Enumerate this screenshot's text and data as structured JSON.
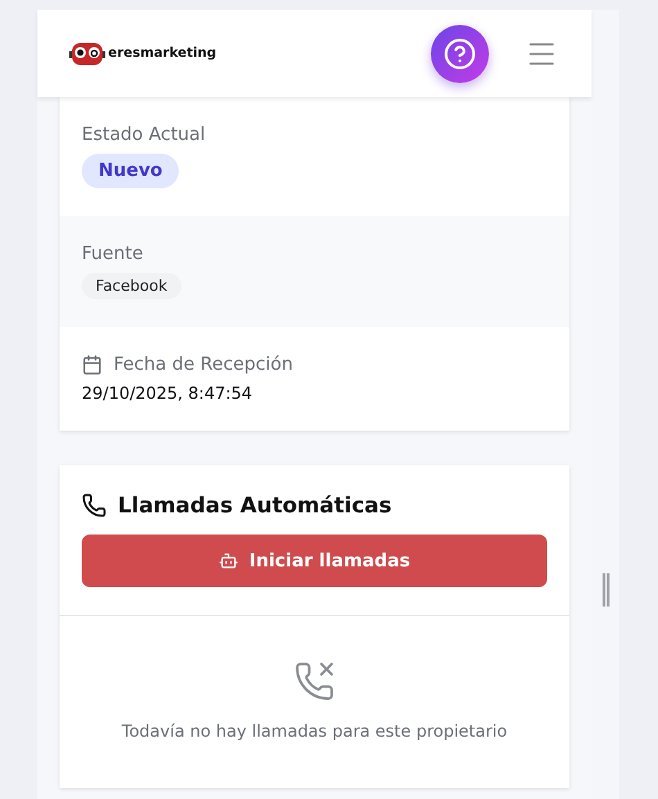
{
  "header": {
    "logo_text": "eresmarketing"
  },
  "details": [
    {
      "kind": "badge",
      "label": "Estado Actual",
      "value": "Nuevo"
    },
    {
      "kind": "chip",
      "label": "Fuente",
      "value": "Facebook"
    },
    {
      "kind": "date",
      "label": "Fecha de Recepción",
      "value": "29/10/2025, 8:47:54"
    }
  ],
  "calls": {
    "title": "Llamadas Automáticas",
    "button": "Iniciar llamadas",
    "empty_message": "Todavía no hay llamadas para este propietario"
  }
}
